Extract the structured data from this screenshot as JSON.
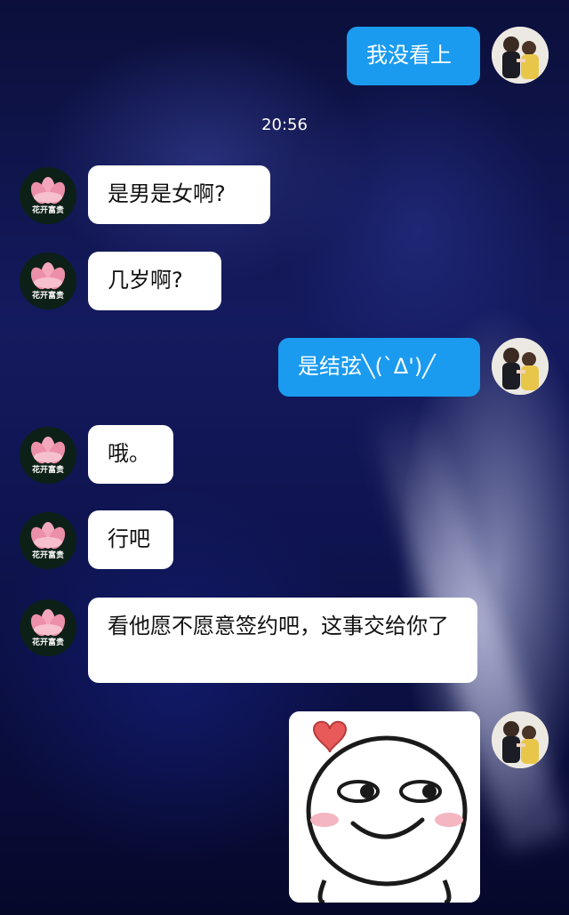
{
  "chat": {
    "timestamp": "20:56",
    "messages": [
      {
        "side": "me",
        "text": "我没看上"
      },
      {
        "side": "other",
        "text": "是男是女啊?"
      },
      {
        "side": "other",
        "text": "几岁啊?"
      },
      {
        "side": "me",
        "text": "是结弦╲(`Δ')╱"
      },
      {
        "side": "other",
        "text": "哦。"
      },
      {
        "side": "other",
        "text": "行吧"
      },
      {
        "side": "other",
        "text": "看他愿不愿意签约吧，这事交给你了"
      },
      {
        "side": "me",
        "type": "sticker",
        "sticker": "smirk-face-with-heart"
      }
    ]
  },
  "avatars": {
    "other_caption": "花开富贵",
    "other_icon": "lotus-flower-icon",
    "me_icon": "couple-photo-avatar"
  },
  "colors": {
    "my_bubble": "#1a9bf0",
    "their_bubble": "#ffffff",
    "background": "#0c1148"
  }
}
